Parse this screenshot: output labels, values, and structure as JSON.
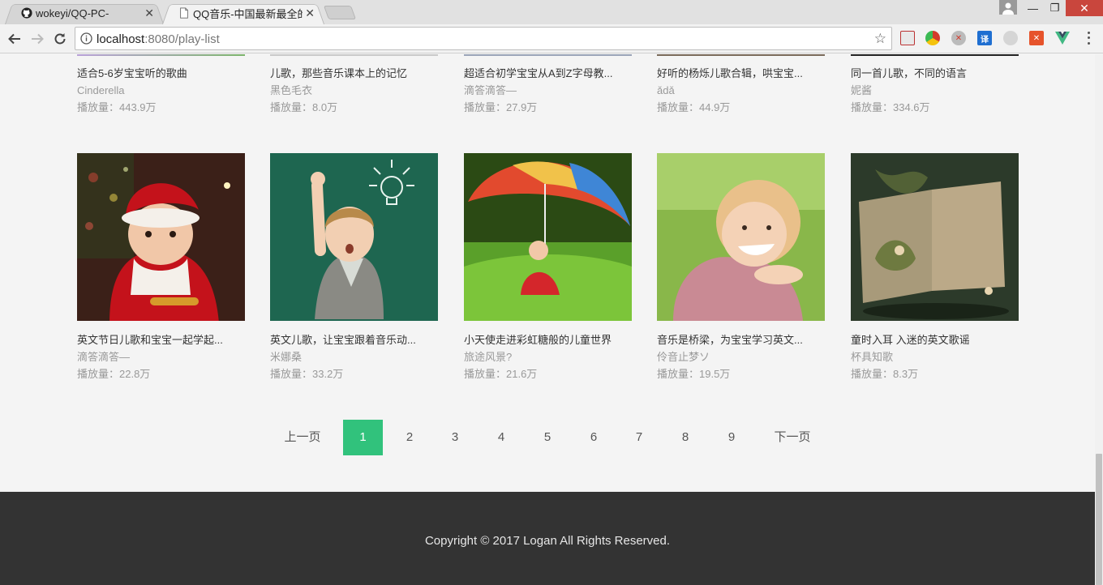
{
  "browser": {
    "tabs": [
      {
        "title": "wokeyi/QQ-PC-",
        "icon": "github-icon",
        "active": false
      },
      {
        "title": "QQ音乐-中国最新最全的",
        "icon": "page-icon",
        "active": true
      }
    ],
    "url_host": "localhost",
    "url_rest": ":8080/play-list",
    "extensions": [
      {
        "name": "notes-extension-icon",
        "color": "#e8e8e8"
      },
      {
        "name": "chrome-extension-icon",
        "color": "#2a8fdb"
      },
      {
        "name": "download-extension-icon",
        "color": "#d33b2c"
      },
      {
        "name": "translate-extension-icon",
        "color": "#1f6fd1",
        "text": "译"
      },
      {
        "name": "gray-extension-icon",
        "color": "#d5d5d5"
      },
      {
        "name": "orange-extension-icon",
        "color": "#e6532b"
      },
      {
        "name": "vue-devtools-icon",
        "color": "#41b883"
      }
    ]
  },
  "playlists_row1": [
    {
      "title": "适合5-6岁宝宝听的歌曲",
      "author": "Cinderella",
      "plays": "播放量：443.9万"
    },
    {
      "title": "儿歌，那些音乐课本上的记忆",
      "author": "黑色毛衣",
      "plays": "播放量：8.0万"
    },
    {
      "title": "超适合初学宝宝从A到Z字母教...",
      "author": "滴答滴答—",
      "plays": "播放量：27.9万"
    },
    {
      "title": "好听的杨烁儿歌合辑，哄宝宝...",
      "author": "ǎdǎ",
      "plays": "播放量：44.9万"
    },
    {
      "title": "同一首儿歌，不同的语言",
      "author": "妮酱",
      "plays": "播放量：334.6万"
    }
  ],
  "playlists_row2": [
    {
      "title": "英文节日儿歌和宝宝一起学起...",
      "author": "滴答滴答—",
      "plays": "播放量：22.8万"
    },
    {
      "title": "英文儿歌，让宝宝跟着音乐动...",
      "author": "米娜桑",
      "plays": "播放量：33.2万"
    },
    {
      "title": "小天使走进彩虹糖般的儿童世界",
      "author": "旅途风景?",
      "plays": "播放量：21.6万"
    },
    {
      "title": "音乐是桥梁，为宝宝学习英文...",
      "author": "伶音止梦ソ",
      "plays": "播放量：19.5万"
    },
    {
      "title": "童时入耳 入迷的英文歌谣",
      "author": "杯具知歌",
      "plays": "播放量：8.3万"
    }
  ],
  "pagination": {
    "prev": "上一页",
    "pages": [
      "1",
      "2",
      "3",
      "4",
      "5",
      "6",
      "7",
      "8",
      "9"
    ],
    "current": "1",
    "next": "下一页"
  },
  "footer": {
    "copyright": "Copyright © 2017 Logan All Rights Reserved."
  },
  "colors": {
    "accent": "#31c27c",
    "footer_bg": "#333333",
    "page_bg": "#f4f4f4"
  }
}
